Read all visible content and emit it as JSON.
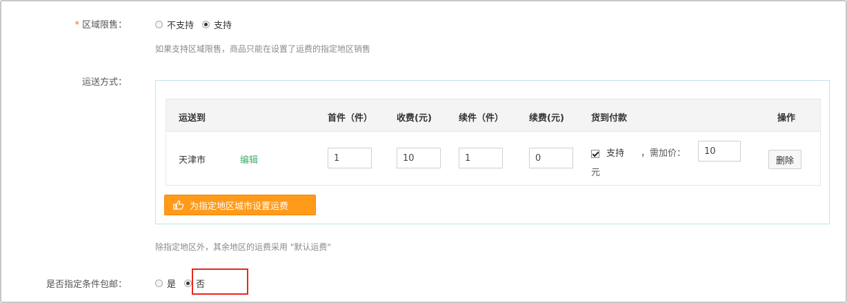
{
  "region_limit": {
    "required_mark": "*",
    "label": "区域限售：",
    "options": [
      {
        "label": "不支持",
        "checked": false
      },
      {
        "label": "支持",
        "checked": true
      }
    ],
    "hint": "如果支持区域限售，商品只能在设置了运费的指定地区销售"
  },
  "shipping": {
    "label": "运送方式：",
    "headers": [
      "运送到",
      "首件（件）",
      "收费(元)",
      "续件（件）",
      "续费(元)",
      "货到付款",
      "操作"
    ],
    "rows": [
      {
        "destination": "天津市",
        "edit_link": "编辑",
        "first_qty": "1",
        "first_fee": "10",
        "extra_qty": "1",
        "extra_fee": "0",
        "cod_checked": true,
        "cod_label": "支持",
        "surcharge_label": "，需加价：",
        "surcharge_value": "10",
        "surcharge_unit": "元",
        "delete_label": "删除"
      }
    ],
    "add_button_label": "为指定地区城市设置运费",
    "add_button_icon": "thumb-pointer-icon",
    "note": "除指定地区外，其余地区的运费采用 \"默认运费\""
  },
  "free_shipping": {
    "label": "是否指定条件包邮：",
    "options": [
      {
        "label": "是",
        "checked": false
      },
      {
        "label": "否",
        "checked": true
      }
    ],
    "highlight_color": "#e8261d"
  },
  "colors": {
    "accent_orange": "#ff9a1a",
    "link_green": "#3fae6a",
    "required_red": "#ff6a00"
  }
}
